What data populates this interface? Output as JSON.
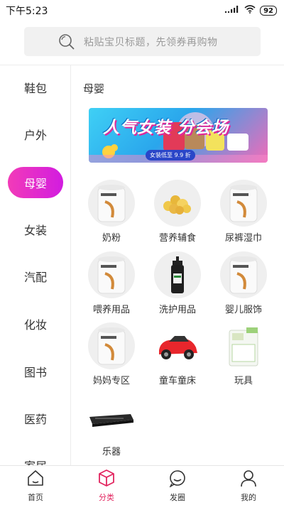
{
  "status_bar": {
    "time": "下午5:23",
    "battery": "92",
    "signal": "signal-icon",
    "wifi": "wifi-icon"
  },
  "search": {
    "placeholder": "粘贴宝贝标题，先领券再购物",
    "icon": "search-icon"
  },
  "sidebar": {
    "items": [
      {
        "label": "鞋包"
      },
      {
        "label": "户外"
      },
      {
        "label": "母婴",
        "active": true
      },
      {
        "label": "女装"
      },
      {
        "label": "汽配"
      },
      {
        "label": "化妆"
      },
      {
        "label": "图书"
      },
      {
        "label": "医药"
      },
      {
        "label": "家居"
      }
    ]
  },
  "section": {
    "title": "母婴",
    "banner": {
      "title": "人气女装 分会场",
      "badge": "女装低至 9.9 折"
    }
  },
  "categories": [
    {
      "label": "奶粉",
      "icon": "milk-powder-can-icon"
    },
    {
      "label": "营养辅食",
      "icon": "baby-food-icon"
    },
    {
      "label": "尿裤湿巾",
      "icon": "milk-powder-can-icon"
    },
    {
      "label": "喂养用品",
      "icon": "milk-powder-can-icon"
    },
    {
      "label": "洗护用品",
      "icon": "lotion-bottle-icon"
    },
    {
      "label": "婴儿服饰",
      "icon": "milk-powder-can-icon"
    },
    {
      "label": "妈妈专区",
      "icon": "milk-powder-can-icon"
    },
    {
      "label": "童车童床",
      "icon": "toy-car-icon"
    },
    {
      "label": "玩具",
      "icon": "toy-box-icon"
    },
    {
      "label": "乐器",
      "icon": "keyboard-instrument-icon"
    }
  ],
  "tabbar": {
    "items": [
      {
        "label": "首页",
        "icon": "home-icon"
      },
      {
        "label": "分类",
        "icon": "category-box-icon",
        "active": true
      },
      {
        "label": "发圈",
        "icon": "chat-circle-icon"
      },
      {
        "label": "我的",
        "icon": "user-icon"
      }
    ]
  },
  "colors": {
    "accent_pink": "#e2255f",
    "sidebar_active_start": "#f23bb8",
    "sidebar_active_end": "#d21ce0"
  }
}
